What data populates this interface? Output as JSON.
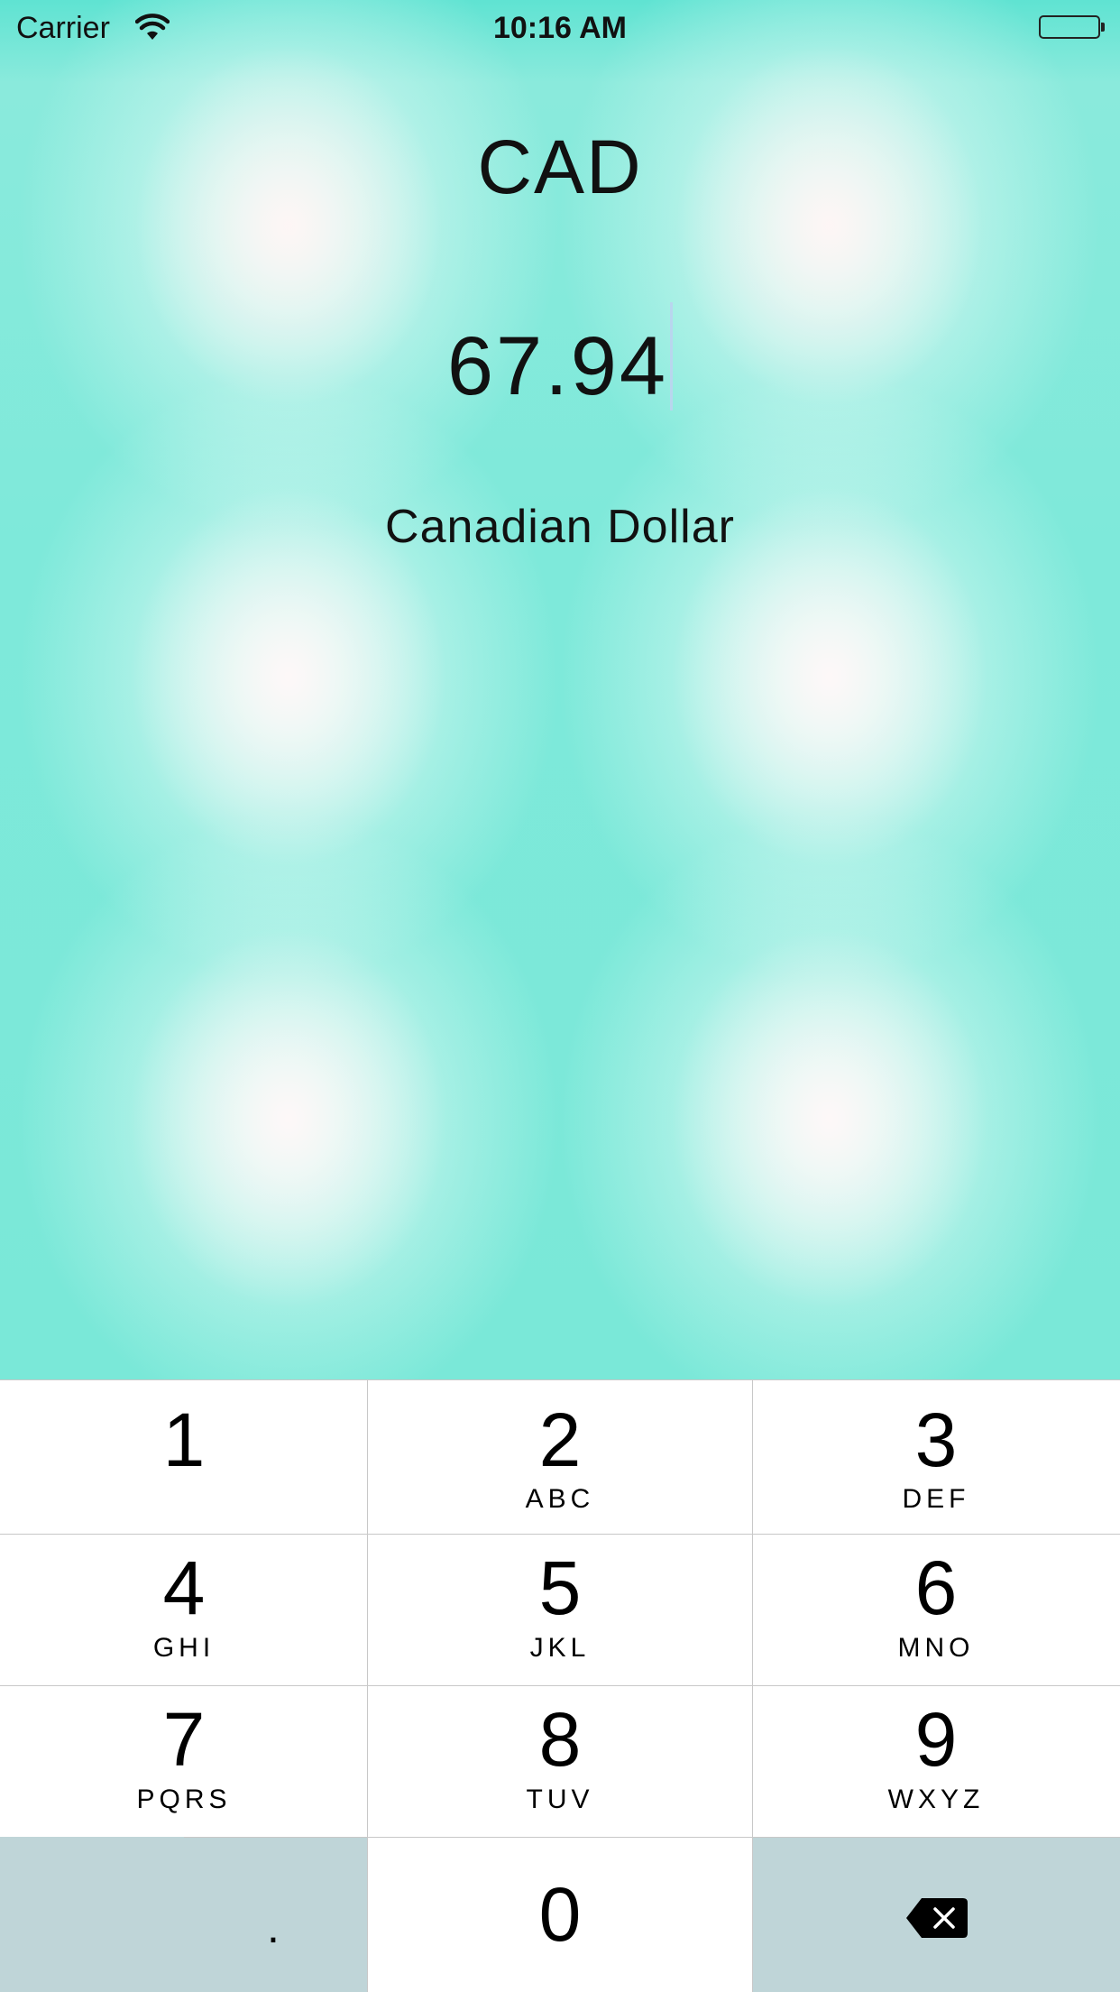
{
  "status_bar": {
    "carrier": "Carrier",
    "time": "10:16 AM",
    "wifi_icon": "wifi-icon",
    "battery_icon": "battery-icon"
  },
  "main": {
    "currency_code": "CAD",
    "amount": "67.94",
    "currency_name": "Canadian Dollar"
  },
  "keypad": {
    "keys": [
      {
        "digit": "1",
        "letters": ""
      },
      {
        "digit": "2",
        "letters": "ABC"
      },
      {
        "digit": "3",
        "letters": "DEF"
      },
      {
        "digit": "4",
        "letters": "GHI"
      },
      {
        "digit": "5",
        "letters": "JKL"
      },
      {
        "digit": "6",
        "letters": "MNO"
      },
      {
        "digit": "7",
        "letters": "PQRS"
      },
      {
        "digit": "8",
        "letters": "TUV"
      },
      {
        "digit": "9",
        "letters": "WXYZ"
      }
    ],
    "decimal": ".",
    "zero": "0",
    "backspace_icon": "backspace-icon"
  },
  "colors": {
    "background_teal": "#5fe3d1",
    "keypad_gray": "#bfd5d8",
    "cursor": "#b9d6ee"
  }
}
